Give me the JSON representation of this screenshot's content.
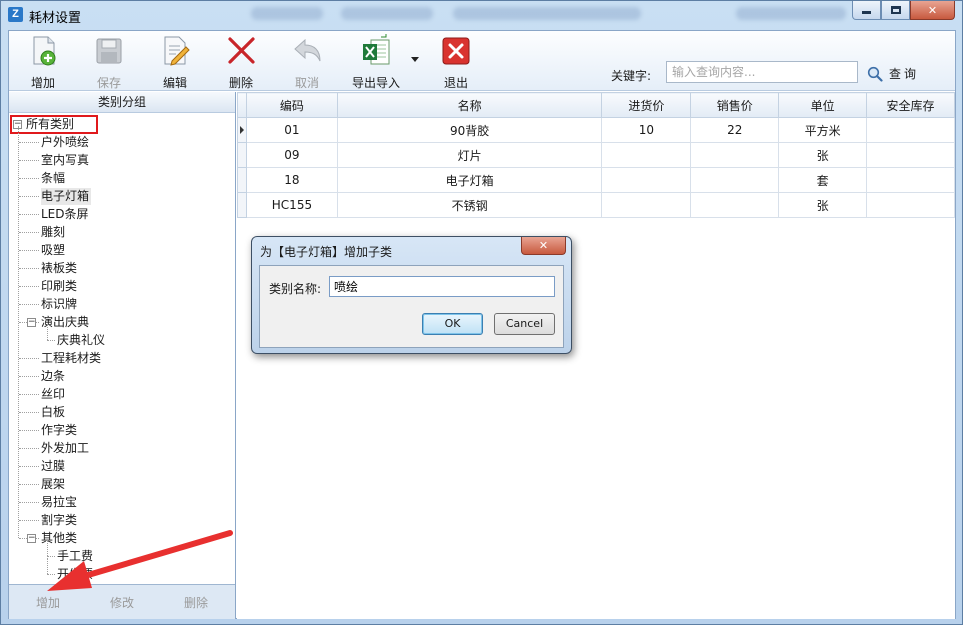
{
  "window": {
    "title": "耗材设置",
    "app_icon_letter": "Z",
    "controls": {
      "minimize": "minimize",
      "maximize": "maximize",
      "close": "✕"
    }
  },
  "toolbar": {
    "buttons": [
      {
        "label": "增加",
        "icon": "add-document-icon",
        "enabled": true
      },
      {
        "label": "保存",
        "icon": "save-disk-icon",
        "enabled": false
      },
      {
        "label": "编辑",
        "icon": "edit-pencil-icon",
        "enabled": true
      },
      {
        "label": "删除",
        "icon": "delete-x-icon",
        "enabled": true
      },
      {
        "label": "取消",
        "icon": "undo-arrow-icon",
        "enabled": false
      },
      {
        "label": "导出导入",
        "icon": "excel-icon",
        "enabled": true
      },
      {
        "label": "退出",
        "icon": "exit-icon",
        "enabled": true
      }
    ],
    "keyword_label": "关键字:",
    "keyword_placeholder": "输入查询内容...",
    "search_label": "查询"
  },
  "category_panel": {
    "header": "类别分组",
    "root": "所有类别",
    "items": [
      {
        "label": "户外喷绘",
        "level": 1
      },
      {
        "label": "室内写真",
        "level": 1
      },
      {
        "label": "条幅",
        "level": 1
      },
      {
        "label": "电子灯箱",
        "level": 1,
        "selected": true
      },
      {
        "label": "LED条屏",
        "level": 1
      },
      {
        "label": "雕刻",
        "level": 1
      },
      {
        "label": "吸塑",
        "level": 1
      },
      {
        "label": "裱板类",
        "level": 1
      },
      {
        "label": "印刷类",
        "level": 1
      },
      {
        "label": "标识牌",
        "level": 1
      },
      {
        "label": "演出庆典",
        "level": 1,
        "expandable": true
      },
      {
        "label": "庆典礼仪",
        "level": 2
      },
      {
        "label": "工程耗材类",
        "level": 1
      },
      {
        "label": "边条",
        "level": 1
      },
      {
        "label": "丝印",
        "level": 1
      },
      {
        "label": "白板",
        "level": 1
      },
      {
        "label": "作字类",
        "level": 1
      },
      {
        "label": "外发加工",
        "level": 1
      },
      {
        "label": "过膜",
        "level": 1
      },
      {
        "label": "展架",
        "level": 1
      },
      {
        "label": "易拉宝",
        "level": 1
      },
      {
        "label": "割字类",
        "level": 1
      },
      {
        "label": "其他类",
        "level": 1,
        "expandable": true
      },
      {
        "label": "手工费",
        "level": 2
      },
      {
        "label": "开发票",
        "level": 2
      }
    ],
    "footer_buttons": [
      "增加",
      "修改",
      "删除"
    ]
  },
  "grid": {
    "columns": [
      "编码",
      "名称",
      "进货价",
      "销售价",
      "单位",
      "安全库存"
    ],
    "rows": [
      [
        "01",
        "90背胶",
        "10",
        "22",
        "平方米",
        ""
      ],
      [
        "09",
        "灯片",
        "",
        "",
        "张",
        ""
      ],
      [
        "18",
        "电子灯箱",
        "",
        "",
        "套",
        ""
      ],
      [
        "HC155",
        "不锈钢",
        "",
        "",
        "张",
        ""
      ]
    ]
  },
  "dialog": {
    "title": "为【电子灯箱】增加子类",
    "close": "✕",
    "field_label": "类别名称:",
    "field_value": "喷绘",
    "ok_label": "OK",
    "cancel_label": "Cancel"
  },
  "colors": {
    "annotation_red": "#e0191c",
    "arrow_red": "#e8302f"
  }
}
